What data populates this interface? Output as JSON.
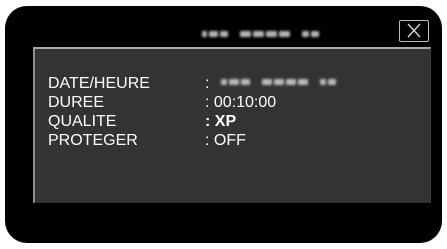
{
  "header": {
    "title_redacted": true,
    "close_icon": "close-icon"
  },
  "info": {
    "rows": [
      {
        "label": "DATE/HEURE",
        "value": ":"
      },
      {
        "label": "DUREE",
        "value": ": 00:10:00"
      },
      {
        "label": "QUALITE",
        "value": ": XP"
      },
      {
        "label": "PROTEGER",
        "value": ": OFF"
      }
    ]
  },
  "colors": {
    "screen_bg": "#000000",
    "panel_bg": "#333333",
    "text": "#ffffff",
    "border": "#a9a9a9"
  }
}
